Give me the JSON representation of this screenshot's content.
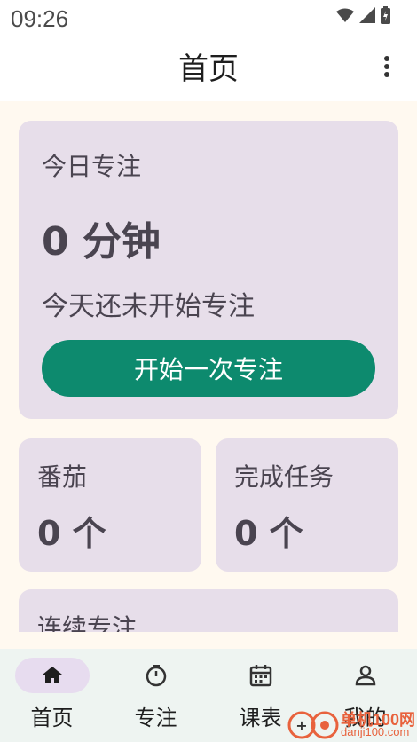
{
  "status_bar": {
    "time": "09:26"
  },
  "app_bar": {
    "title": "首页"
  },
  "today_card": {
    "label": "今日专注",
    "value": "0 分钟",
    "subtitle": "今天还未开始专注",
    "button_label": "开始一次专注"
  },
  "stats": [
    {
      "label": "番茄",
      "value": "0 个"
    },
    {
      "label": "完成任务",
      "value": "0 个"
    }
  ],
  "streak_card": {
    "label": "连续专注"
  },
  "bottom_nav": {
    "items": [
      {
        "label": "首页",
        "icon": "home-icon",
        "active": true
      },
      {
        "label": "专注",
        "icon": "timer-icon",
        "active": false
      },
      {
        "label": "课表",
        "icon": "calendar-icon",
        "active": false
      },
      {
        "label": "我的",
        "icon": "person-icon",
        "active": false
      }
    ]
  },
  "watermark": {
    "name": "单机100网",
    "url": "danji100.com"
  },
  "colors": {
    "accent_button": "#0D8A6E",
    "card_bg": "#E7DEEA",
    "page_bg": "#FFF9F0",
    "nav_bg": "#EEF4F1"
  }
}
